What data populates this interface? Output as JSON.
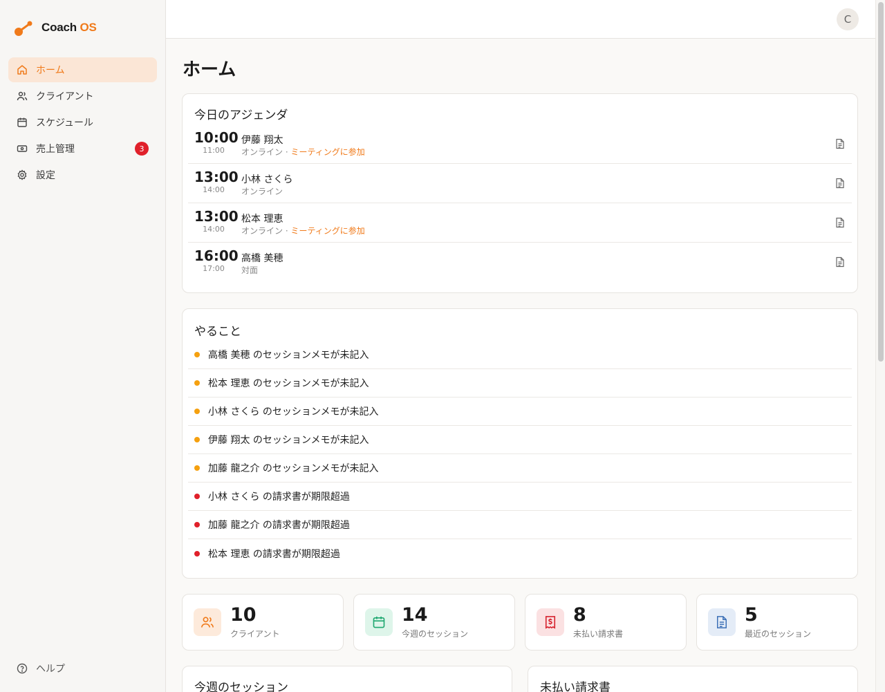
{
  "brand": {
    "name": "Coach",
    "accent": "OS"
  },
  "sidebar": {
    "items": [
      {
        "label": "ホーム",
        "icon": "home-icon",
        "active": true
      },
      {
        "label": "クライアント",
        "icon": "users-icon"
      },
      {
        "label": "スケジュール",
        "icon": "calendar-icon"
      },
      {
        "label": "売上管理",
        "icon": "wallet-icon",
        "badge": "3"
      },
      {
        "label": "設定",
        "icon": "gear-icon"
      }
    ],
    "help": "ヘルプ"
  },
  "topbar": {
    "avatar": "C"
  },
  "page": {
    "title": "ホーム"
  },
  "agenda": {
    "title": "今日のアジェンダ",
    "rows": [
      {
        "start": "10:00",
        "end": "11:00",
        "name": "伊藤 翔太",
        "mode": "オンライン",
        "sep": " · ",
        "link": "ミーティングに参加"
      },
      {
        "start": "13:00",
        "end": "14:00",
        "name": "小林 さくら",
        "mode": "オンライン",
        "sep": "",
        "link": ""
      },
      {
        "start": "13:00",
        "end": "14:00",
        "name": "松本 理恵",
        "mode": "オンライン",
        "sep": " · ",
        "link": "ミーティングに参加"
      },
      {
        "start": "16:00",
        "end": "17:00",
        "name": "高橋 美穂",
        "mode": "対面",
        "sep": "",
        "link": ""
      }
    ]
  },
  "todo": {
    "title": "やること",
    "items": [
      {
        "text": "高橋 美穂 のセッションメモが未記入",
        "level": "warn"
      },
      {
        "text": "松本 理恵 のセッションメモが未記入",
        "level": "warn"
      },
      {
        "text": "小林 さくら のセッションメモが未記入",
        "level": "warn"
      },
      {
        "text": "伊藤 翔太 のセッションメモが未記入",
        "level": "warn"
      },
      {
        "text": "加藤 龍之介 のセッションメモが未記入",
        "level": "warn"
      },
      {
        "text": "小林 さくら の請求書が期限超過",
        "level": "danger"
      },
      {
        "text": "加藤 龍之介 の請求書が期限超過",
        "level": "danger"
      },
      {
        "text": "松本 理恵 の請求書が期限超過",
        "level": "danger"
      }
    ]
  },
  "stats": [
    {
      "value": "10",
      "label": "クライアント",
      "icon": "users-icon"
    },
    {
      "value": "14",
      "label": "今週のセッション",
      "icon": "calendar-icon"
    },
    {
      "value": "8",
      "label": "未払い請求書",
      "icon": "invoice-dollar-icon"
    },
    {
      "value": "5",
      "label": "最近のセッション",
      "icon": "document-icon"
    }
  ],
  "sections": {
    "week_sessions": "今週のセッション",
    "unpaid_invoices": "未払い請求書"
  },
  "colors": {
    "accent": "#f07a1a",
    "warn": "#f5a00f",
    "danger": "#e0202a",
    "green": "#1fa870",
    "red": "#d6232f",
    "blue": "#3b6fb6"
  }
}
